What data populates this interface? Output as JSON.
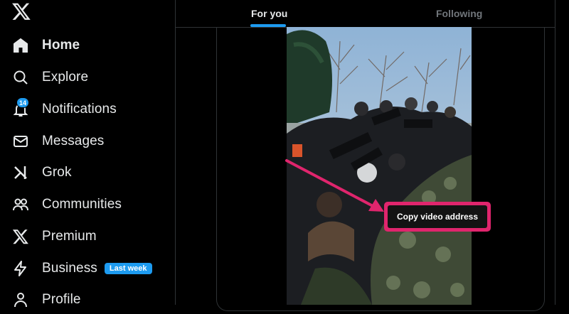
{
  "sidebar": {
    "logo": "x-logo-icon",
    "items": [
      {
        "label": "Home",
        "icon": "home-icon",
        "active": true
      },
      {
        "label": "Explore",
        "icon": "search-icon"
      },
      {
        "label": "Notifications",
        "icon": "bell-icon",
        "badge": "14"
      },
      {
        "label": "Messages",
        "icon": "envelope-icon"
      },
      {
        "label": "Grok",
        "icon": "grok-icon"
      },
      {
        "label": "Communities",
        "icon": "communities-icon"
      },
      {
        "label": "Premium",
        "icon": "x-logo-icon"
      },
      {
        "label": "Business",
        "icon": "lightning-icon",
        "tag": "Last week"
      },
      {
        "label": "Profile",
        "icon": "person-icon"
      }
    ]
  },
  "tabs": [
    {
      "label": "For you",
      "active": true
    },
    {
      "label": "Following",
      "active": false
    }
  ],
  "context_menu": {
    "item": "Copy video address"
  },
  "colors": {
    "accent": "#1d9bf0",
    "annotation": "#e0256d",
    "background": "#000000",
    "border": "#2f3336"
  }
}
